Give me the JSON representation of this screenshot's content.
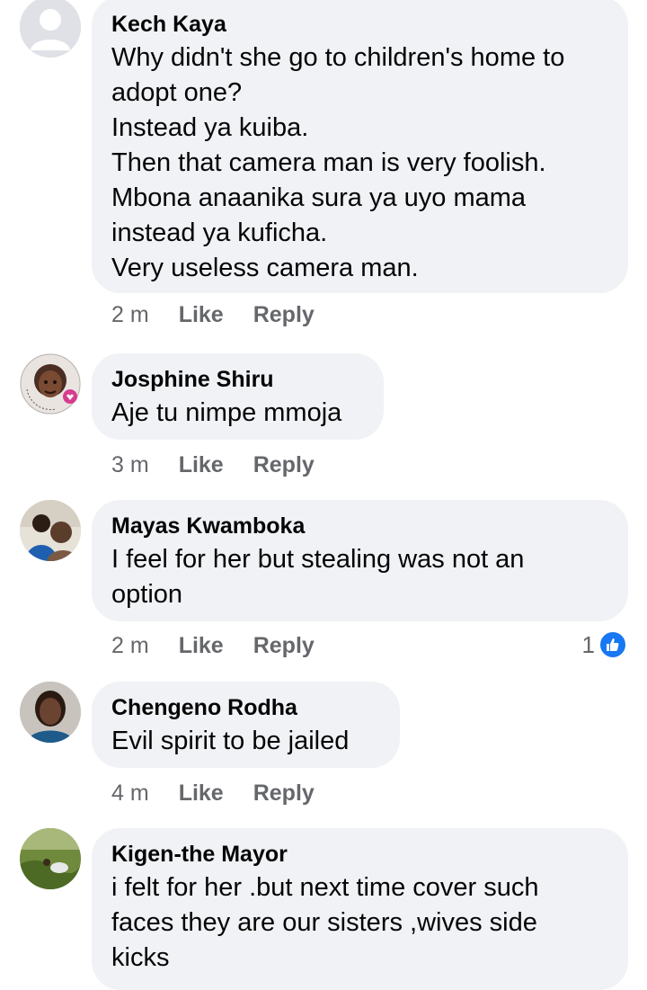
{
  "comments": [
    {
      "author": "Kech Kaya",
      "lines": [
        "Why didn't she  go to  children's home to",
        "adopt one?",
        "Instead ya kuiba.",
        "Then that camera man is very foolish.",
        "Mbona anaanika sura ya uyo mama",
        "instead ya kuficha.",
        "Very useless camera man."
      ],
      "time": "2 m",
      "like_label": "Like",
      "reply_label": "Reply",
      "avatar_icon": "default-profile-icon"
    },
    {
      "author": "Josphine Shiru",
      "lines": [
        "Aje tu nimpe mmoja"
      ],
      "time": "3 m",
      "like_label": "Like",
      "reply_label": "Reply",
      "avatar_icon": "profile-photo"
    },
    {
      "author": "Mayas Kwamboka",
      "lines": [
        "I feel for her but stealing was not an",
        "option"
      ],
      "time": "2 m",
      "like_label": "Like",
      "reply_label": "Reply",
      "reaction_count": "1",
      "reaction_icon": "thumbs-up-icon",
      "avatar_icon": "profile-photo"
    },
    {
      "author": "Chengeno Rodha",
      "lines": [
        "Evil spirit to be jailed"
      ],
      "time": "4 m",
      "like_label": "Like",
      "reply_label": "Reply",
      "avatar_icon": "profile-photo"
    },
    {
      "author": "Kigen-the Mayor",
      "lines": [
        "i felt for her  .but next time cover such",
        "faces they are our sisters ,wives side",
        "kicks"
      ],
      "avatar_icon": "profile-photo"
    }
  ],
  "colors": {
    "bubble": "#f0f2f5",
    "meta_text": "#65676b",
    "like_blue": "#1877f2"
  }
}
